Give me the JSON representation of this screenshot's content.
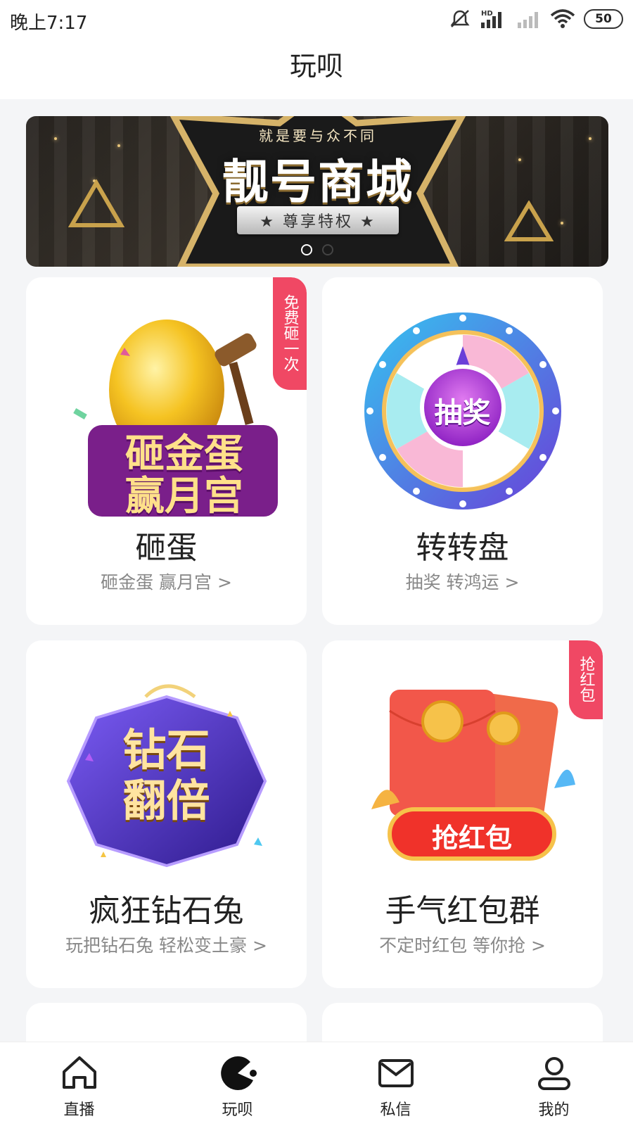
{
  "status_bar": {
    "time": "晚上7:17",
    "network_label": "HD",
    "battery": "50"
  },
  "header": {
    "title": "玩呗"
  },
  "banner": {
    "slogan": "就是要与众不同",
    "title": "靓号商城",
    "ribbon": "★ 尊享特权 ★",
    "page_count": 2,
    "active_page": 1
  },
  "cards": [
    {
      "art_text": [
        "砸金蛋",
        "赢月宫"
      ],
      "title": "砸蛋",
      "subtitle": "砸金蛋 赢月宫 >",
      "tag": "免费砸一次"
    },
    {
      "art_text": [
        "抽奖"
      ],
      "title": "转转盘",
      "subtitle": "抽奖 转鸿运 >",
      "tag": ""
    },
    {
      "art_text": [
        "钻石",
        "翻倍"
      ],
      "title": "疯狂钻石兔",
      "subtitle": "玩把钻石兔 轻松变土豪 >",
      "tag": ""
    },
    {
      "art_text": [
        "抢红包"
      ],
      "title": "手气红包群",
      "subtitle": "不定时红包 等你抢 >",
      "tag": "抢红包"
    }
  ],
  "bottom_nav": [
    {
      "label": "直播",
      "icon": "home-icon"
    },
    {
      "label": "玩呗",
      "icon": "pacman-icon",
      "active": true
    },
    {
      "label": "私信",
      "icon": "mail-icon"
    },
    {
      "label": "我的",
      "icon": "user-icon"
    }
  ],
  "colors": {
    "tag": "#f04864",
    "background": "#f4f5f7",
    "text": "#222222",
    "subtext": "#888888"
  }
}
